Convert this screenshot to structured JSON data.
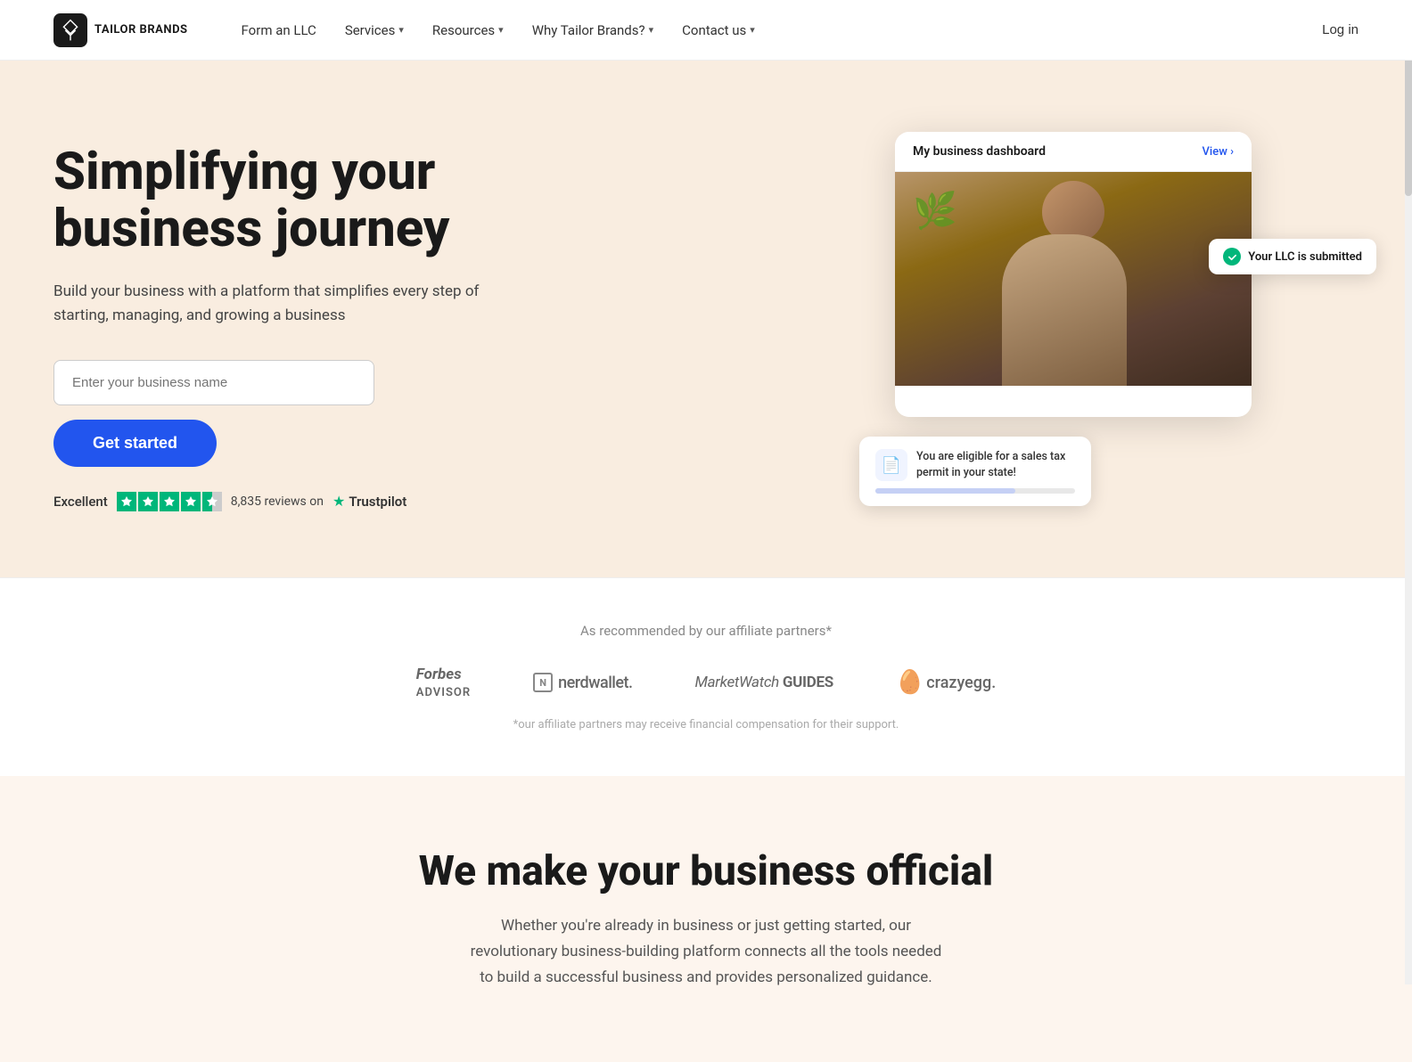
{
  "brand": {
    "name": "TAILOR BRANDS",
    "logo_alt": "Tailor Brands logo"
  },
  "nav": {
    "form_llc": "Form an LLC",
    "services": "Services",
    "resources": "Resources",
    "why_tailor": "Why Tailor Brands?",
    "contact": "Contact us",
    "login": "Log in"
  },
  "hero": {
    "title": "Simplifying your business journey",
    "subtitle": "Build your business with a platform that simplifies every step of starting, managing, and growing a business",
    "input_placeholder": "Enter your business name",
    "cta_button": "Get started",
    "trust": {
      "excellent_label": "Excellent",
      "reviews_text": "8,835 reviews on",
      "trustpilot": "Trustpilot"
    },
    "dashboard": {
      "title": "My business dashboard",
      "view_link": "View ›",
      "llc_badge": "Your LLC is submitted",
      "tax_card": "You are eligible for a sales tax permit in your state!"
    }
  },
  "partners": {
    "tagline": "As recommended by our affiliate partners*",
    "logos": [
      "Forbes ADVISOR",
      "nerdwallet.",
      "MarketWatch GUIDES",
      "crazyegg."
    ],
    "disclaimer": "*our affiliate partners may receive financial compensation for their support."
  },
  "bottom": {
    "title": "We make your business official",
    "subtitle": "Whether you're already in business or just getting started, our revolutionary business-building platform connects all the tools needed to build a successful business and provides personalized guidance."
  }
}
